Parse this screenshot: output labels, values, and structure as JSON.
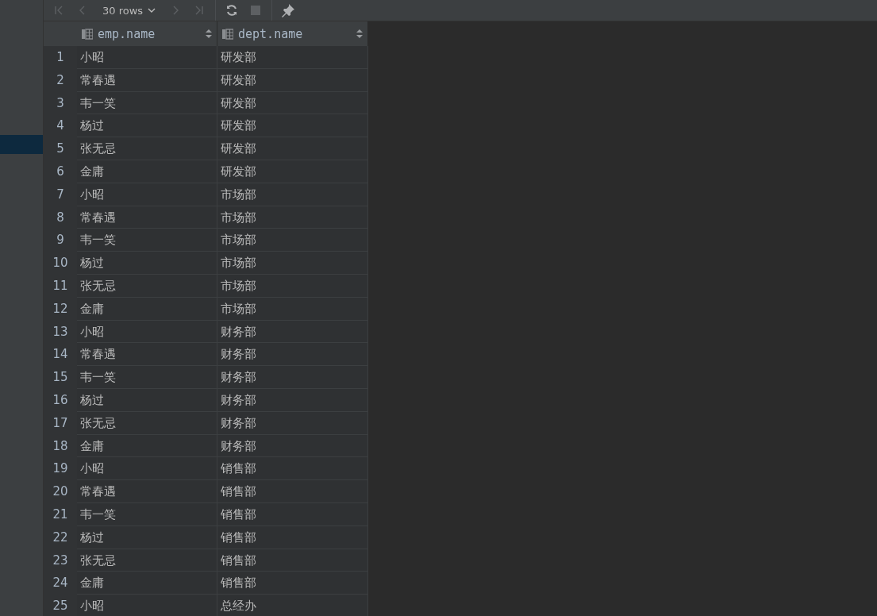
{
  "toolbar": {
    "nav_buttons": [
      {
        "kind": "first",
        "disabled": true
      },
      {
        "kind": "prev",
        "disabled": true
      }
    ],
    "page_size": "30 rows",
    "nav_buttons_after": [
      {
        "kind": "next",
        "disabled": true
      },
      {
        "kind": "last",
        "disabled": true
      }
    ],
    "actions": [
      {
        "kind": "refresh",
        "disabled": false
      },
      {
        "kind": "stop",
        "disabled": true
      },
      {
        "kind": "pin",
        "disabled": false
      }
    ]
  },
  "table": {
    "columns": [
      "emp.name",
      "dept.name"
    ],
    "rows": [
      {
        "n": "1",
        "cells": [
          "小昭",
          "研发部"
        ]
      },
      {
        "n": "2",
        "cells": [
          "常春遇",
          "研发部"
        ]
      },
      {
        "n": "3",
        "cells": [
          "韦一笑",
          "研发部"
        ]
      },
      {
        "n": "4",
        "cells": [
          "杨过",
          "研发部"
        ]
      },
      {
        "n": "5",
        "cells": [
          "张无忌",
          "研发部"
        ]
      },
      {
        "n": "6",
        "cells": [
          "金庸",
          "研发部"
        ]
      },
      {
        "n": "7",
        "cells": [
          "小昭",
          "市场部"
        ]
      },
      {
        "n": "8",
        "cells": [
          "常春遇",
          "市场部"
        ]
      },
      {
        "n": "9",
        "cells": [
          "韦一笑",
          "市场部"
        ]
      },
      {
        "n": "10",
        "cells": [
          "杨过",
          "市场部"
        ]
      },
      {
        "n": "11",
        "cells": [
          "张无忌",
          "市场部"
        ]
      },
      {
        "n": "12",
        "cells": [
          "金庸",
          "市场部"
        ]
      },
      {
        "n": "13",
        "cells": [
          "小昭",
          "财务部"
        ]
      },
      {
        "n": "14",
        "cells": [
          "常春遇",
          "财务部"
        ]
      },
      {
        "n": "15",
        "cells": [
          "韦一笑",
          "财务部"
        ]
      },
      {
        "n": "16",
        "cells": [
          "杨过",
          "财务部"
        ]
      },
      {
        "n": "17",
        "cells": [
          "张无忌",
          "财务部"
        ]
      },
      {
        "n": "18",
        "cells": [
          "金庸",
          "财务部"
        ]
      },
      {
        "n": "19",
        "cells": [
          "小昭",
          "销售部"
        ]
      },
      {
        "n": "20",
        "cells": [
          "常春遇",
          "销售部"
        ]
      },
      {
        "n": "21",
        "cells": [
          "韦一笑",
          "销售部"
        ]
      },
      {
        "n": "22",
        "cells": [
          "杨过",
          "销售部"
        ]
      },
      {
        "n": "23",
        "cells": [
          "张无忌",
          "销售部"
        ]
      },
      {
        "n": "24",
        "cells": [
          "金庸",
          "销售部"
        ]
      },
      {
        "n": "25",
        "cells": [
          "小昭",
          "总经办"
        ]
      }
    ]
  }
}
